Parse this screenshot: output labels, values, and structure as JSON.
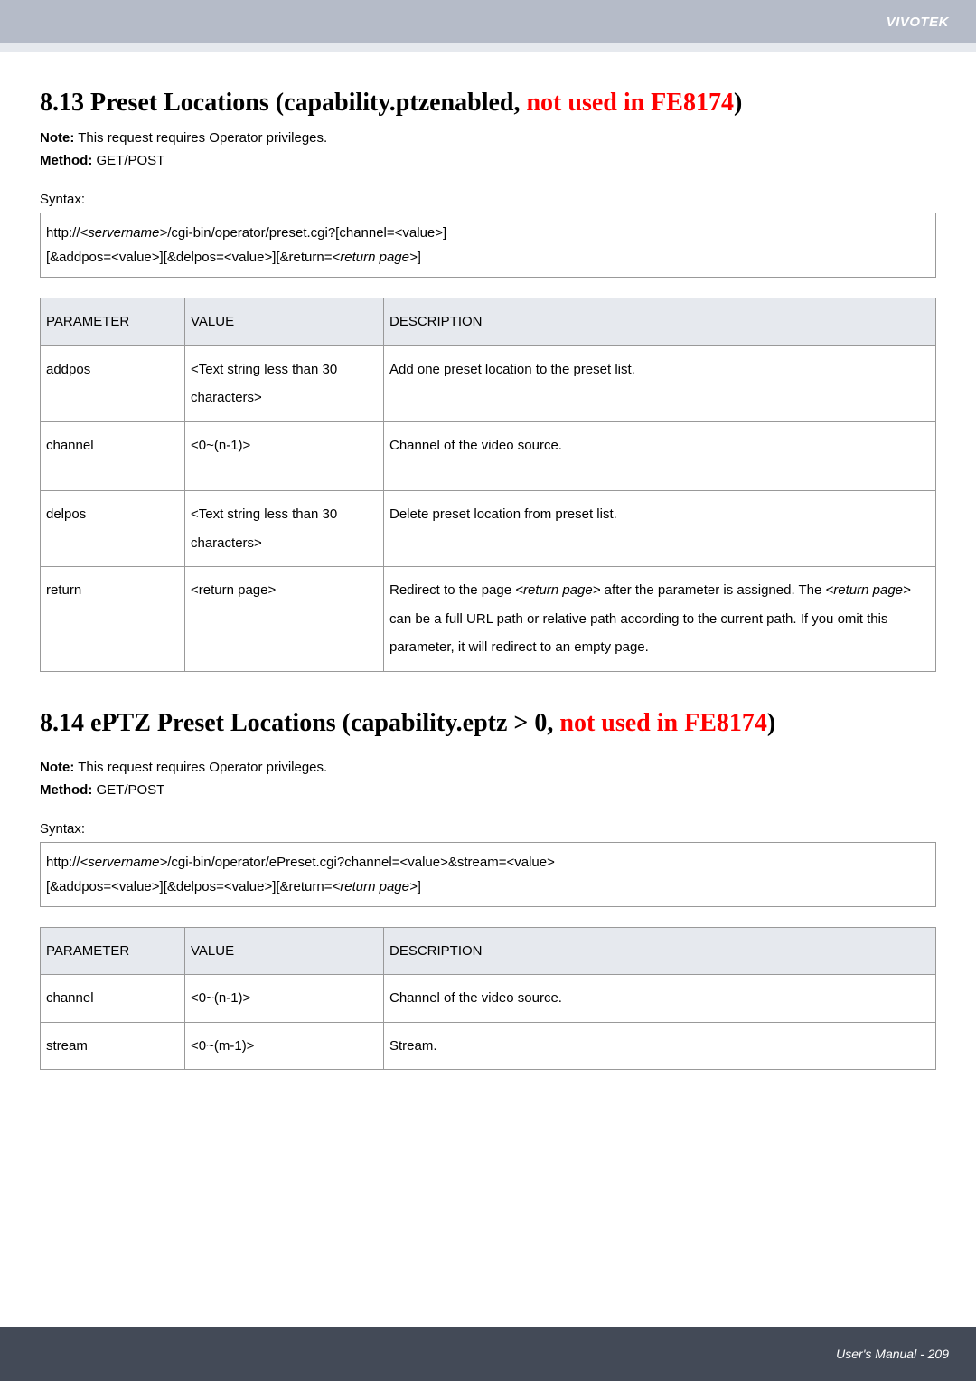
{
  "brand": "VIVOTEK",
  "footer": "User's Manual - 209",
  "section1": {
    "heading_prefix": "8.13 Preset Locations (capability.ptzenabled, ",
    "heading_red": "not used in FE8174",
    "heading_suffix": ")",
    "note_label": "Note:",
    "note_text": " This request requires Operator privileges.",
    "method_label": "Method:",
    "method_text": " GET/POST",
    "syntax_label": "Syntax:",
    "syntax_lines": {
      "l1a": "http://",
      "l1b": "<servername>",
      "l1c": "/cgi-bin/operator/preset.cgi?[channel=<value>]",
      "l2a": "[&addpos=<value>][&delpos=<value>][&return=",
      "l2b": "<return page>",
      "l2c": "]"
    },
    "table": {
      "h_param": "PARAMETER",
      "h_value": "VALUE",
      "h_desc": "DESCRIPTION",
      "rows": [
        {
          "param": "addpos",
          "value": "<Text string less than 30 characters>",
          "desc": "Add one preset location to the preset list."
        },
        {
          "param": "channel",
          "value": "<0~(n-1)>",
          "desc": "Channel of the video source."
        },
        {
          "param": "delpos",
          "value": "<Text string less than 30 characters>",
          "desc": "Delete preset location from preset list."
        },
        {
          "param": "return",
          "value": "<return page>",
          "desc_p1": "Redirect to the page ",
          "desc_i1": "<return page>",
          "desc_p2": " after the parameter is assigned. The ",
          "desc_i2": "<return page>",
          "desc_p3": " can be a full URL path or relative path according to the current path. If you omit this parameter, it will redirect to an empty page."
        }
      ]
    }
  },
  "section2": {
    "heading_prefix": "8.14 ePTZ Preset Locations (capability.eptz > 0, ",
    "heading_red": "not used in FE8174",
    "heading_suffix": ")",
    "note_label": "Note:",
    "note_text": " This request requires Operator privileges.",
    "method_label": "Method:",
    "method_text": " GET/POST",
    "syntax_label": "Syntax:",
    "syntax_lines": {
      "l1a": "http://",
      "l1b": "<servername>",
      "l1c": "/cgi-bin/operator/ePreset.cgi?channel=<value>&stream=<value>",
      "l2a": "[&addpos=<value>][&delpos=<value>][&return=",
      "l2b": "<return page>",
      "l2c": "]"
    },
    "table": {
      "h_param": "PARAMETER",
      "h_value": "VALUE",
      "h_desc": "DESCRIPTION",
      "rows": [
        {
          "param": "channel",
          "value": "<0~(n-1)>",
          "desc": "Channel of the video source."
        },
        {
          "param": "stream",
          "value": "<0~(m-1)>",
          "desc": "Stream."
        }
      ]
    }
  }
}
